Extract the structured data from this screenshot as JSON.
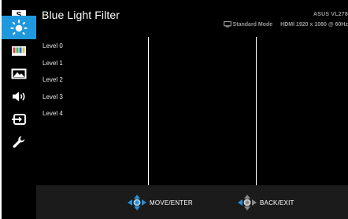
{
  "header": {
    "title": "Blue Light Filter",
    "model": "ASUS VL278",
    "mode": "Standard Mode",
    "input": "HDMI 1920 x 1080 @ 60Hz"
  },
  "sidebar": {
    "items": [
      {
        "icon": "splendid-icon"
      },
      {
        "icon": "blue-light-filter-icon",
        "active": true
      },
      {
        "icon": "color-icon"
      },
      {
        "icon": "image-icon"
      },
      {
        "icon": "sound-icon"
      },
      {
        "icon": "input-select-icon"
      },
      {
        "icon": "system-setup-icon"
      }
    ]
  },
  "options": [
    "Level 0",
    "Level 1",
    "Level 2",
    "Level 3",
    "Level 4"
  ],
  "footer": {
    "move_label": "MOVE/ENTER",
    "back_label": "BACK/EXIT"
  },
  "colors": {
    "accent": "#1f98de",
    "background": "#000000",
    "footer": "#1b1b1b",
    "dpad": "#2a8fd8"
  }
}
